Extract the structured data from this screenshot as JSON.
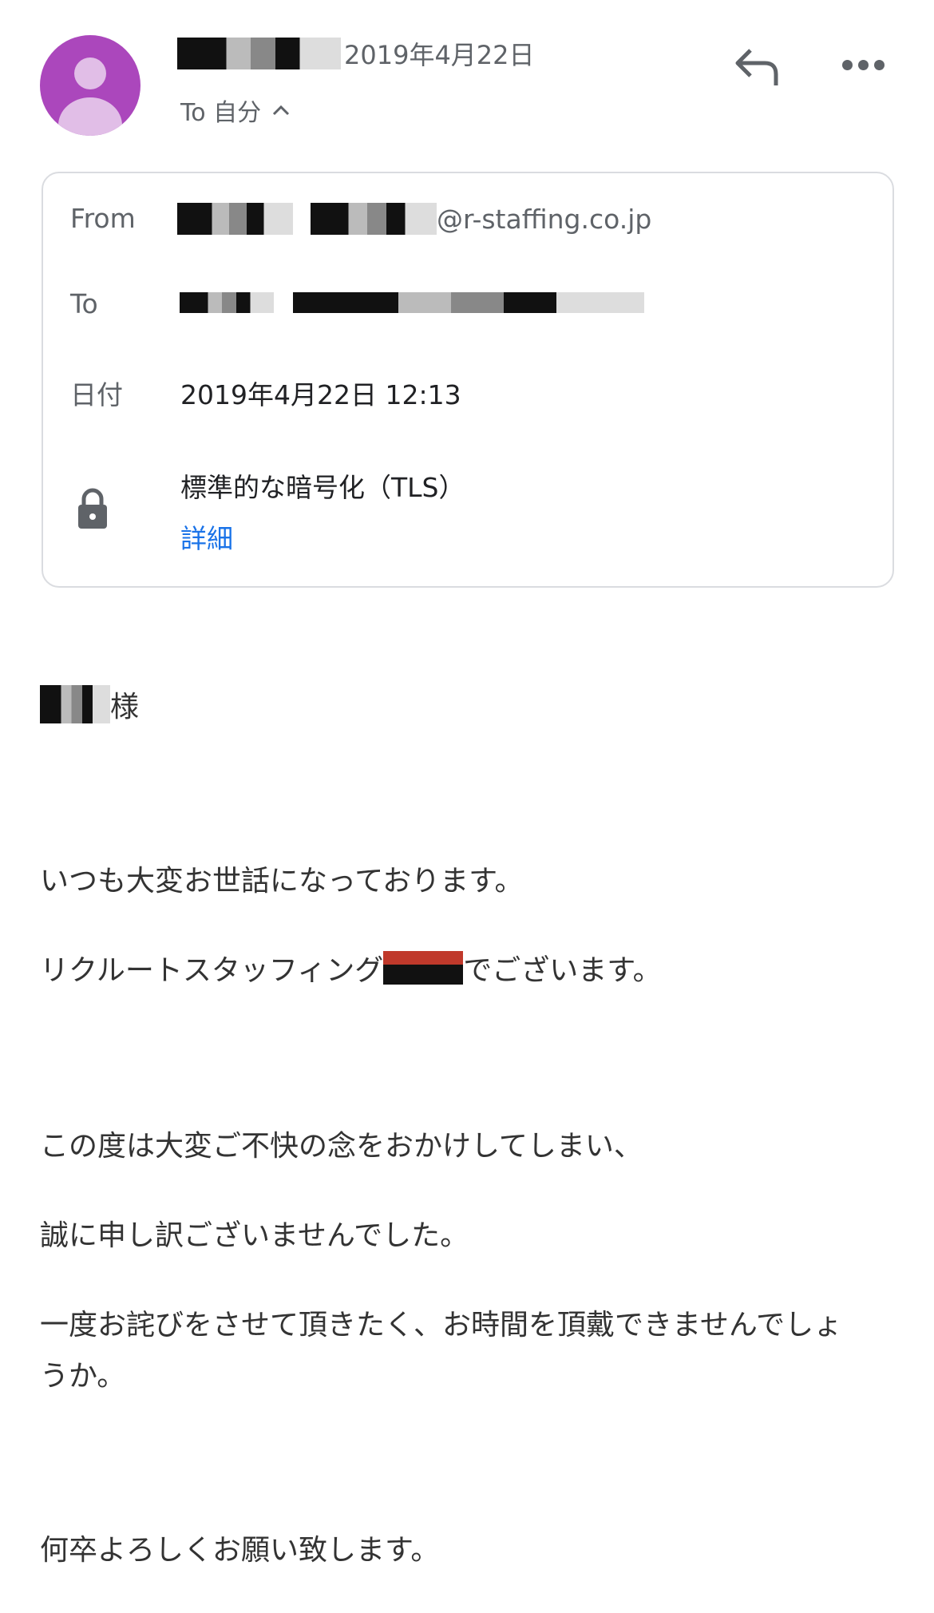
{
  "header": {
    "avatar_icon": "person-avatar-icon",
    "sender_name": "[redacted]",
    "date": "2019年4月22日",
    "to_label": "To 自分",
    "expand_icon": "chevron-up-icon",
    "reply_icon": "reply-icon",
    "more_icon": "more-horiz-icon",
    "avatar_color": "#ab47bc"
  },
  "details": {
    "from_label": "From",
    "from_value_suffix": "@r-staffing.co.jp",
    "to_label": "To",
    "to_value": "[redacted]",
    "date_label": "日付",
    "date_value": "2019年4月22日 12:13",
    "security_icon": "lock-icon",
    "security_text": "標準的な暗号化（TLS）",
    "details_link": "詳細",
    "link_color": "#1a73e8"
  },
  "body": {
    "salutation_suffix": "様",
    "lines": [
      "いつも大変お世話になっております。",
      "リクルートスタッフィング",
      "でございます。",
      "この度は大変ご不快の念をおかけしてしまい、",
      "誠に申し訳ございませんでした。",
      "一度お詫びをさせて頂きたく、お時間を頂戴できませんでしょ",
      "うか。",
      "何卒よろしくお願い致します。"
    ]
  }
}
